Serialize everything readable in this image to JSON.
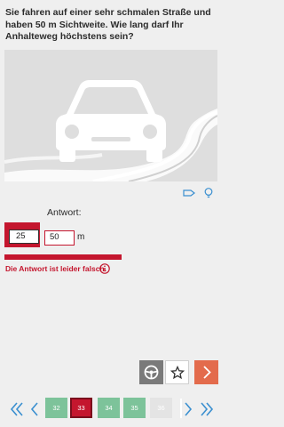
{
  "question": {
    "text": "Sie fahren auf einer sehr schmalen Straße und haben 50 m Sichtweite. Wie lang darf Ihr Anhalteweg höchstens sein?"
  },
  "image": {
    "icon": "car-on-winding-road"
  },
  "tools": {
    "icons": [
      "road-sign-icon",
      "lightbulb-icon"
    ]
  },
  "answer": {
    "label": "Antwort:",
    "correct_value": "25",
    "user_value": "50",
    "unit": "m"
  },
  "feedback": {
    "message": "Die Antwort ist leider falsch.",
    "icon": "info-icon"
  },
  "actions": {
    "icons": [
      "steering-wheel-icon",
      "star-icon",
      "chevron-right-icon"
    ]
  },
  "pager": {
    "pages": [
      {
        "label": "32",
        "state": "answered"
      },
      {
        "label": "33",
        "state": "current-wrong"
      },
      {
        "label": "34",
        "state": "answered"
      },
      {
        "label": "35",
        "state": "answered"
      },
      {
        "label": "36",
        "state": "unanswered"
      }
    ]
  },
  "colors": {
    "accent_red": "#c4162e",
    "answered_green": "#7dc39a",
    "next_orange": "#e36b4c",
    "background": "#efefef"
  }
}
